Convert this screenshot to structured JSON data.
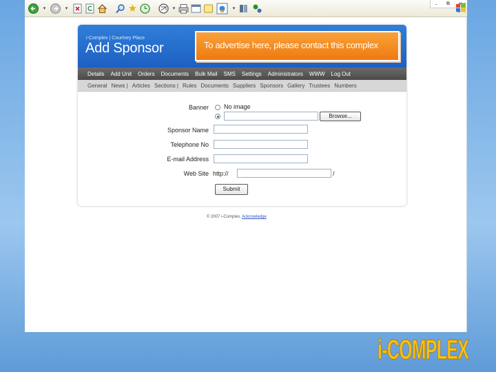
{
  "browser": {
    "toolbar_icons": [
      "back-icon",
      "forward-icon",
      "stop-icon",
      "refresh-icon",
      "home-icon",
      "search-icon",
      "favorites-icon",
      "history-icon",
      "mail-icon",
      "print-icon",
      "edit-icon",
      "discuss-icon",
      "messenger-icon",
      "research-icon",
      "tools-icon"
    ]
  },
  "header": {
    "org_name": "i-Complex | Courtney Place",
    "page_title": "Add Sponsor",
    "ad_banner": "To advertise here, please contact this complex"
  },
  "nav_primary": [
    "Details",
    "Add Unit",
    "Orders",
    "Documents",
    "Bulk Mail",
    "SMS",
    "Settings",
    "Administrators",
    "WWW",
    "Log Out"
  ],
  "nav_secondary": [
    "General",
    "News |",
    "Articles",
    "Sections |",
    "Rules",
    "Documents",
    "Suppliers",
    "Sponsors",
    "Gallery",
    "Trustees",
    "Numbers"
  ],
  "form": {
    "banner_label": "Banner",
    "banner_option_none": "No image",
    "browse_label": "Browse...",
    "sponsor_name_label": "Sponsor Name",
    "telephone_label": "Telephone No",
    "email_label": "E-mail Address",
    "website_label": "Web Site",
    "website_prefix": "http://",
    "website_suffix": "/",
    "submit_label": "Submit"
  },
  "footer": {
    "copyright": "© 2007 i-Complex.",
    "link": "Acknowledge"
  },
  "brand": "i-COMPLEX"
}
